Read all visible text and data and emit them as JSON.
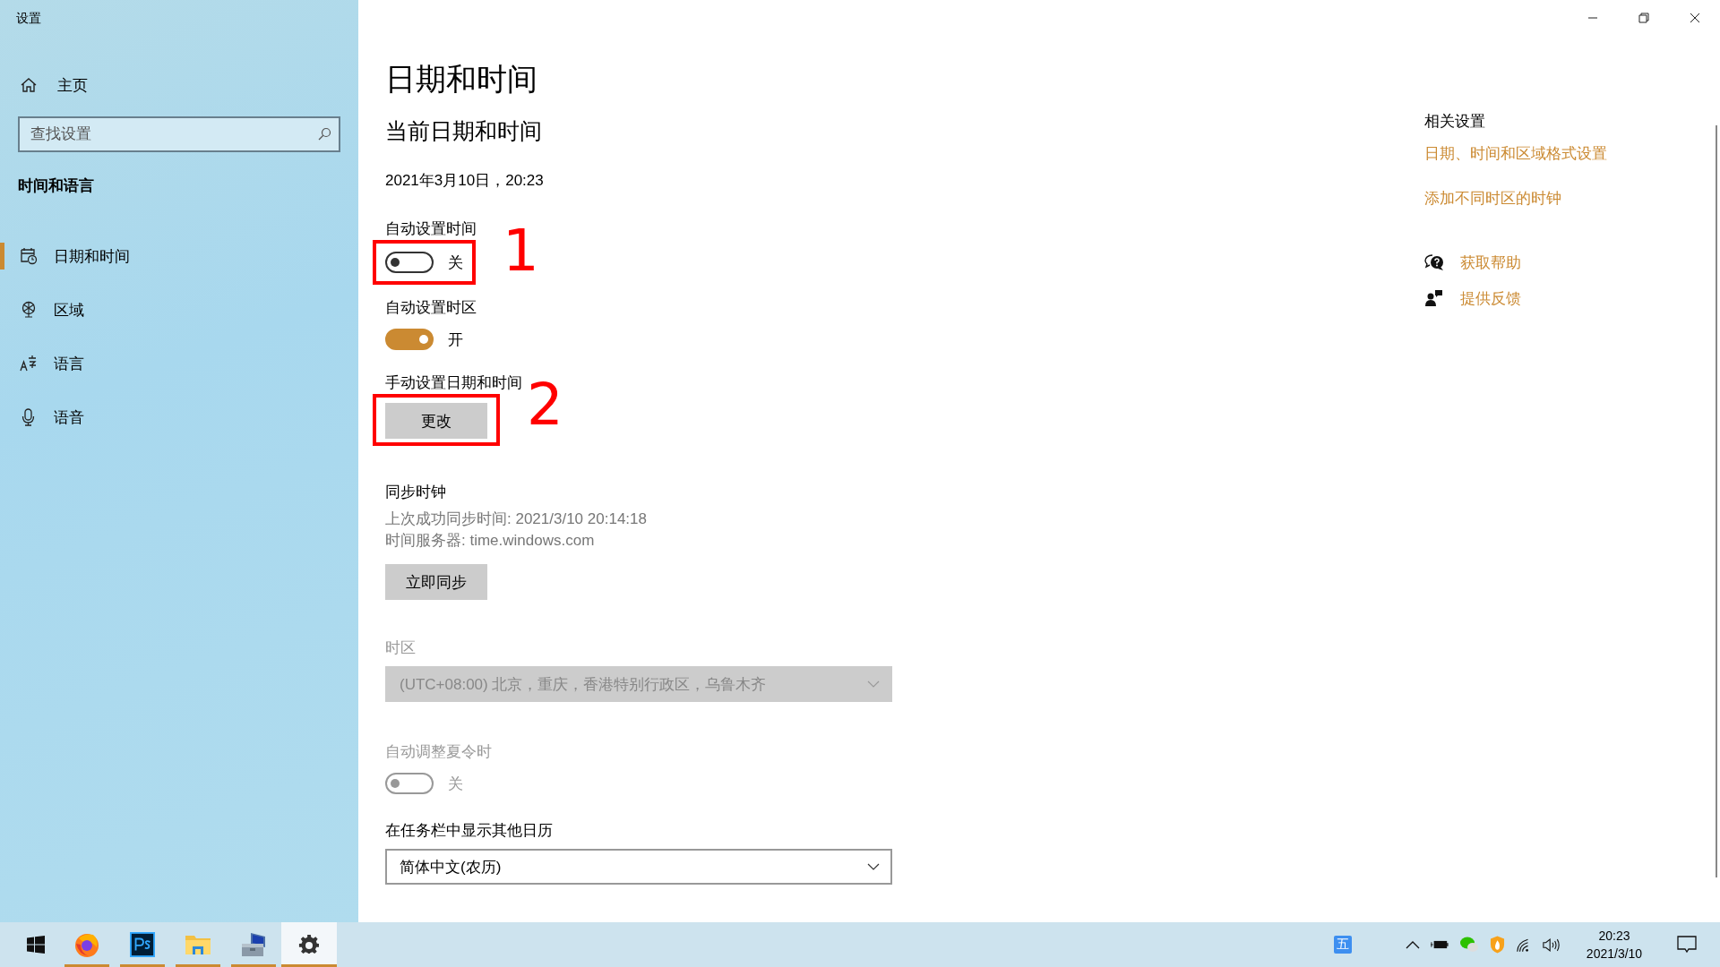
{
  "window": {
    "title": "设置"
  },
  "sidebar": {
    "home": "主页",
    "search": {
      "placeholder": "查找设置"
    },
    "section": "时间和语言",
    "items": [
      {
        "label": "日期和时间",
        "selected": true
      },
      {
        "label": "区域",
        "selected": false
      },
      {
        "label": "语言",
        "selected": false
      },
      {
        "label": "语音",
        "selected": false
      }
    ]
  },
  "main": {
    "title": "日期和时间",
    "subtitle": "当前日期和时间",
    "current_datetime": "2021年3月10日，20:23",
    "settings": [
      {
        "kind": "toggle",
        "label": "自动设置时间",
        "on": false,
        "state_text": "关",
        "disabled": false,
        "annotation": "1"
      },
      {
        "kind": "toggle",
        "label": "自动设置时区",
        "on": true,
        "state_text": "开",
        "disabled": false
      },
      {
        "kind": "button",
        "label": "手动设置日期和时间",
        "button": "更改",
        "annotation": "2"
      },
      {
        "kind": "sync",
        "label": "同步时钟",
        "lines": [
          "上次成功同步时间: 2021/3/10 20:14:18",
          "时间服务器: time.windows.com"
        ],
        "button": "立即同步"
      },
      {
        "kind": "dropdown",
        "label": "时区",
        "value": "(UTC+08:00) 北京，重庆，香港特别行政区，乌鲁木齐",
        "disabled": true
      },
      {
        "kind": "toggle",
        "label": "自动调整夏令时",
        "on": false,
        "state_text": "关",
        "disabled": true
      },
      {
        "kind": "dropdown",
        "label": "在任务栏中显示其他日历",
        "value": "简体中文(农历)",
        "disabled": false
      }
    ]
  },
  "related": {
    "title": "相关设置",
    "links": [
      "日期、时间和区域格式设置",
      "添加不同时区的时钟"
    ],
    "help": [
      {
        "label": "获取帮助"
      },
      {
        "label": "提供反馈"
      }
    ]
  },
  "taskbar": {
    "apps": [
      {
        "running": true,
        "selected": false
      },
      {
        "running": true,
        "selected": false
      },
      {
        "running": true,
        "selected": false
      },
      {
        "running": true,
        "selected": false
      },
      {
        "running": true,
        "selected": true
      }
    ],
    "ime": "五",
    "time": "20:23",
    "date": "2021/3/10"
  }
}
